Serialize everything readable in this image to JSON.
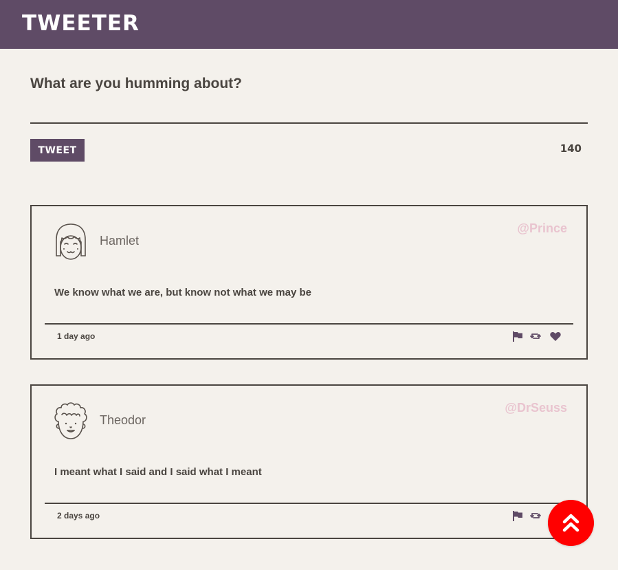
{
  "header": {
    "brand": "TWEETER"
  },
  "compose": {
    "title": "What are you humming about?",
    "input_value": "",
    "button_label": "TWEET",
    "char_counter": "140"
  },
  "tweets": [
    {
      "name": "Hamlet",
      "handle": "@Prince",
      "text": "We know what we are, but know not what we may be",
      "time": "1 day ago",
      "avatar_icon": "girl-avatar-icon"
    },
    {
      "name": "Theodor",
      "handle": "@DrSeuss",
      "text": "I meant what I said and I said what I meant",
      "time": "2 days ago",
      "avatar_icon": "curly-hair-avatar-icon"
    }
  ],
  "icons": {
    "flag": "flag-icon",
    "retweet": "retweet-icon",
    "like": "heart-icon",
    "scroll_top": "double-chevron-up-icon"
  },
  "colors": {
    "nav_bg": "#5f4b66",
    "page_bg": "#f4f1ec",
    "text": "#4a4540",
    "handle": "#e9c4cf",
    "accent_button": "#5f4b66",
    "scroll_button": "#ff0000"
  }
}
